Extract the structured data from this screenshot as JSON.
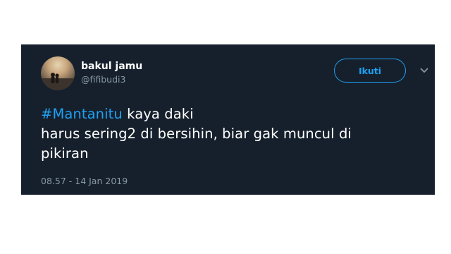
{
  "user": {
    "display_name": "bakul jamu",
    "handle": "@fifibudi3"
  },
  "follow_button": {
    "label": "Ikuti"
  },
  "tweet": {
    "hashtag": "#Mantanitu",
    "line1_rest": " kaya daki",
    "line2": "harus sering2 di bersihin, biar gak muncul di",
    "line3": "pikiran",
    "timestamp": "08.57 - 14 Jan 2019"
  },
  "colors": {
    "card_background": "#16202c",
    "accent": "#1da1f2",
    "secondary_text": "#8899a6",
    "primary_text": "#ffffff"
  },
  "icons": {
    "avatar": "avatar-silhouette-sunset",
    "menu": "chevron-down-icon"
  }
}
